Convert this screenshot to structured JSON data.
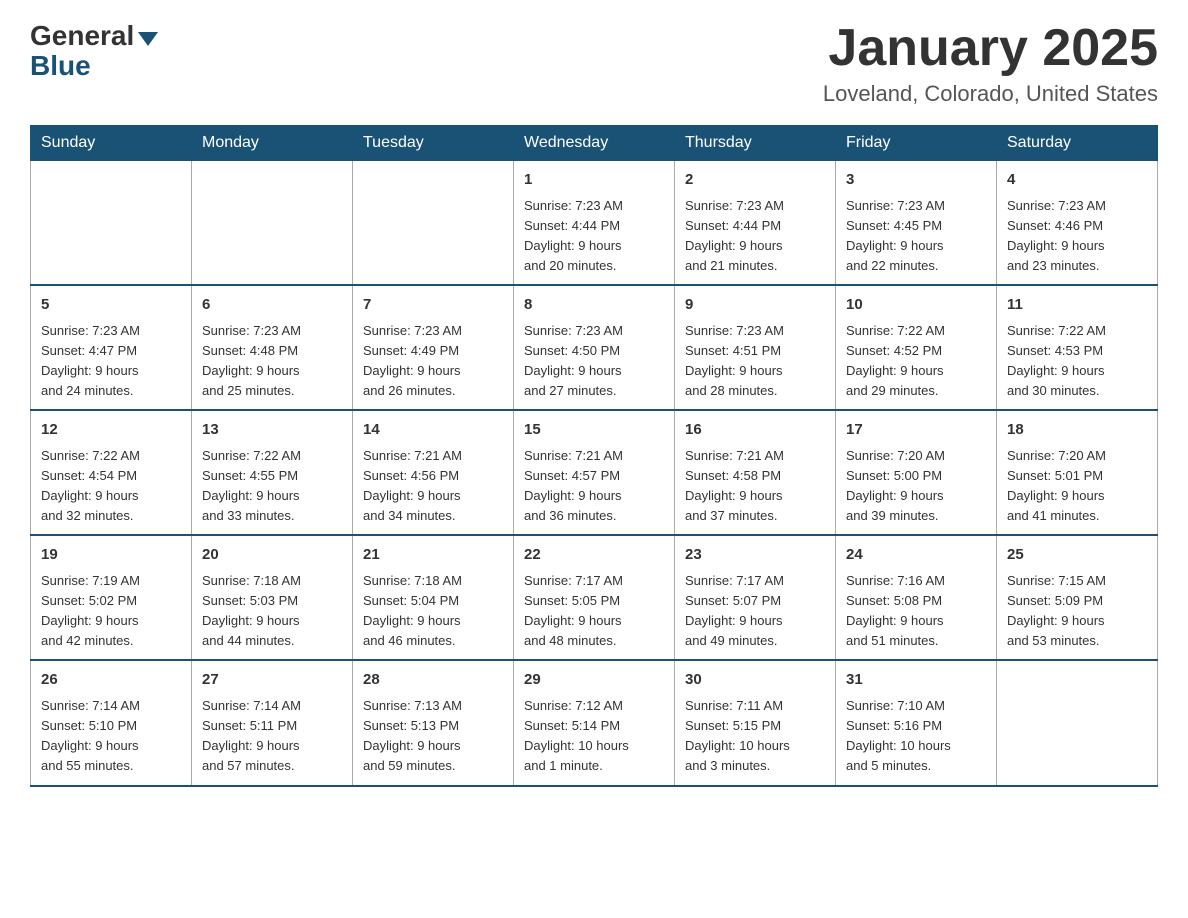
{
  "header": {
    "logo_general": "General",
    "logo_blue": "Blue",
    "title": "January 2025",
    "subtitle": "Loveland, Colorado, United States"
  },
  "days_of_week": [
    "Sunday",
    "Monday",
    "Tuesday",
    "Wednesday",
    "Thursday",
    "Friday",
    "Saturday"
  ],
  "weeks": [
    [
      {
        "day": "",
        "info": ""
      },
      {
        "day": "",
        "info": ""
      },
      {
        "day": "",
        "info": ""
      },
      {
        "day": "1",
        "info": "Sunrise: 7:23 AM\nSunset: 4:44 PM\nDaylight: 9 hours\nand 20 minutes."
      },
      {
        "day": "2",
        "info": "Sunrise: 7:23 AM\nSunset: 4:44 PM\nDaylight: 9 hours\nand 21 minutes."
      },
      {
        "day": "3",
        "info": "Sunrise: 7:23 AM\nSunset: 4:45 PM\nDaylight: 9 hours\nand 22 minutes."
      },
      {
        "day": "4",
        "info": "Sunrise: 7:23 AM\nSunset: 4:46 PM\nDaylight: 9 hours\nand 23 minutes."
      }
    ],
    [
      {
        "day": "5",
        "info": "Sunrise: 7:23 AM\nSunset: 4:47 PM\nDaylight: 9 hours\nand 24 minutes."
      },
      {
        "day": "6",
        "info": "Sunrise: 7:23 AM\nSunset: 4:48 PM\nDaylight: 9 hours\nand 25 minutes."
      },
      {
        "day": "7",
        "info": "Sunrise: 7:23 AM\nSunset: 4:49 PM\nDaylight: 9 hours\nand 26 minutes."
      },
      {
        "day": "8",
        "info": "Sunrise: 7:23 AM\nSunset: 4:50 PM\nDaylight: 9 hours\nand 27 minutes."
      },
      {
        "day": "9",
        "info": "Sunrise: 7:23 AM\nSunset: 4:51 PM\nDaylight: 9 hours\nand 28 minutes."
      },
      {
        "day": "10",
        "info": "Sunrise: 7:22 AM\nSunset: 4:52 PM\nDaylight: 9 hours\nand 29 minutes."
      },
      {
        "day": "11",
        "info": "Sunrise: 7:22 AM\nSunset: 4:53 PM\nDaylight: 9 hours\nand 30 minutes."
      }
    ],
    [
      {
        "day": "12",
        "info": "Sunrise: 7:22 AM\nSunset: 4:54 PM\nDaylight: 9 hours\nand 32 minutes."
      },
      {
        "day": "13",
        "info": "Sunrise: 7:22 AM\nSunset: 4:55 PM\nDaylight: 9 hours\nand 33 minutes."
      },
      {
        "day": "14",
        "info": "Sunrise: 7:21 AM\nSunset: 4:56 PM\nDaylight: 9 hours\nand 34 minutes."
      },
      {
        "day": "15",
        "info": "Sunrise: 7:21 AM\nSunset: 4:57 PM\nDaylight: 9 hours\nand 36 minutes."
      },
      {
        "day": "16",
        "info": "Sunrise: 7:21 AM\nSunset: 4:58 PM\nDaylight: 9 hours\nand 37 minutes."
      },
      {
        "day": "17",
        "info": "Sunrise: 7:20 AM\nSunset: 5:00 PM\nDaylight: 9 hours\nand 39 minutes."
      },
      {
        "day": "18",
        "info": "Sunrise: 7:20 AM\nSunset: 5:01 PM\nDaylight: 9 hours\nand 41 minutes."
      }
    ],
    [
      {
        "day": "19",
        "info": "Sunrise: 7:19 AM\nSunset: 5:02 PM\nDaylight: 9 hours\nand 42 minutes."
      },
      {
        "day": "20",
        "info": "Sunrise: 7:18 AM\nSunset: 5:03 PM\nDaylight: 9 hours\nand 44 minutes."
      },
      {
        "day": "21",
        "info": "Sunrise: 7:18 AM\nSunset: 5:04 PM\nDaylight: 9 hours\nand 46 minutes."
      },
      {
        "day": "22",
        "info": "Sunrise: 7:17 AM\nSunset: 5:05 PM\nDaylight: 9 hours\nand 48 minutes."
      },
      {
        "day": "23",
        "info": "Sunrise: 7:17 AM\nSunset: 5:07 PM\nDaylight: 9 hours\nand 49 minutes."
      },
      {
        "day": "24",
        "info": "Sunrise: 7:16 AM\nSunset: 5:08 PM\nDaylight: 9 hours\nand 51 minutes."
      },
      {
        "day": "25",
        "info": "Sunrise: 7:15 AM\nSunset: 5:09 PM\nDaylight: 9 hours\nand 53 minutes."
      }
    ],
    [
      {
        "day": "26",
        "info": "Sunrise: 7:14 AM\nSunset: 5:10 PM\nDaylight: 9 hours\nand 55 minutes."
      },
      {
        "day": "27",
        "info": "Sunrise: 7:14 AM\nSunset: 5:11 PM\nDaylight: 9 hours\nand 57 minutes."
      },
      {
        "day": "28",
        "info": "Sunrise: 7:13 AM\nSunset: 5:13 PM\nDaylight: 9 hours\nand 59 minutes."
      },
      {
        "day": "29",
        "info": "Sunrise: 7:12 AM\nSunset: 5:14 PM\nDaylight: 10 hours\nand 1 minute."
      },
      {
        "day": "30",
        "info": "Sunrise: 7:11 AM\nSunset: 5:15 PM\nDaylight: 10 hours\nand 3 minutes."
      },
      {
        "day": "31",
        "info": "Sunrise: 7:10 AM\nSunset: 5:16 PM\nDaylight: 10 hours\nand 5 minutes."
      },
      {
        "day": "",
        "info": ""
      }
    ]
  ]
}
